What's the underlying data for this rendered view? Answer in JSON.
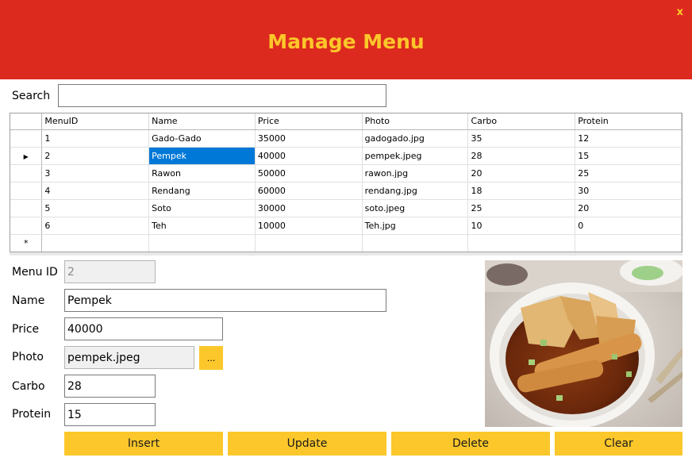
{
  "window": {
    "title": "Manage Menu",
    "close_label": "x"
  },
  "search": {
    "label": "Search",
    "value": ""
  },
  "grid": {
    "columns": [
      "MenuID",
      "Name",
      "Price",
      "Photo",
      "Carbo",
      "Protein"
    ],
    "rows": [
      [
        "1",
        "Gado-Gado",
        "35000",
        "gadogado.jpg",
        "35",
        "12"
      ],
      [
        "2",
        "Pempek",
        "40000",
        "pempek.jpeg",
        "28",
        "15"
      ],
      [
        "3",
        "Rawon",
        "50000",
        "rawon.jpg",
        "20",
        "25"
      ],
      [
        "4",
        "Rendang",
        "60000",
        "rendang.jpg",
        "18",
        "30"
      ],
      [
        "5",
        "Soto",
        "30000",
        "soto.jpeg",
        "25",
        "20"
      ],
      [
        "6",
        "Teh",
        "10000",
        "Teh.jpg",
        "10",
        "0"
      ]
    ],
    "current_row_marker": "▶",
    "new_row_marker": "*",
    "selected_row": 1,
    "selected_col": 1
  },
  "form": {
    "menu_id": {
      "label": "Menu ID",
      "value": "2"
    },
    "name": {
      "label": "Name",
      "value": "Pempek"
    },
    "price": {
      "label": "Price",
      "value": "40000"
    },
    "photo": {
      "label": "Photo",
      "value": "pempek.jpeg",
      "browse_label": "..."
    },
    "carbo": {
      "label": "Carbo",
      "value": "28"
    },
    "protein": {
      "label": "Protein",
      "value": "15"
    }
  },
  "buttons": {
    "insert": "Insert",
    "update": "Update",
    "delete": "Delete",
    "clear": "Clear"
  },
  "colors": {
    "header_bg": "#dc2b1e",
    "accent": "#fcc72a",
    "selection": "#0078d7"
  },
  "photo_preview": {
    "icon": "food-photo"
  }
}
